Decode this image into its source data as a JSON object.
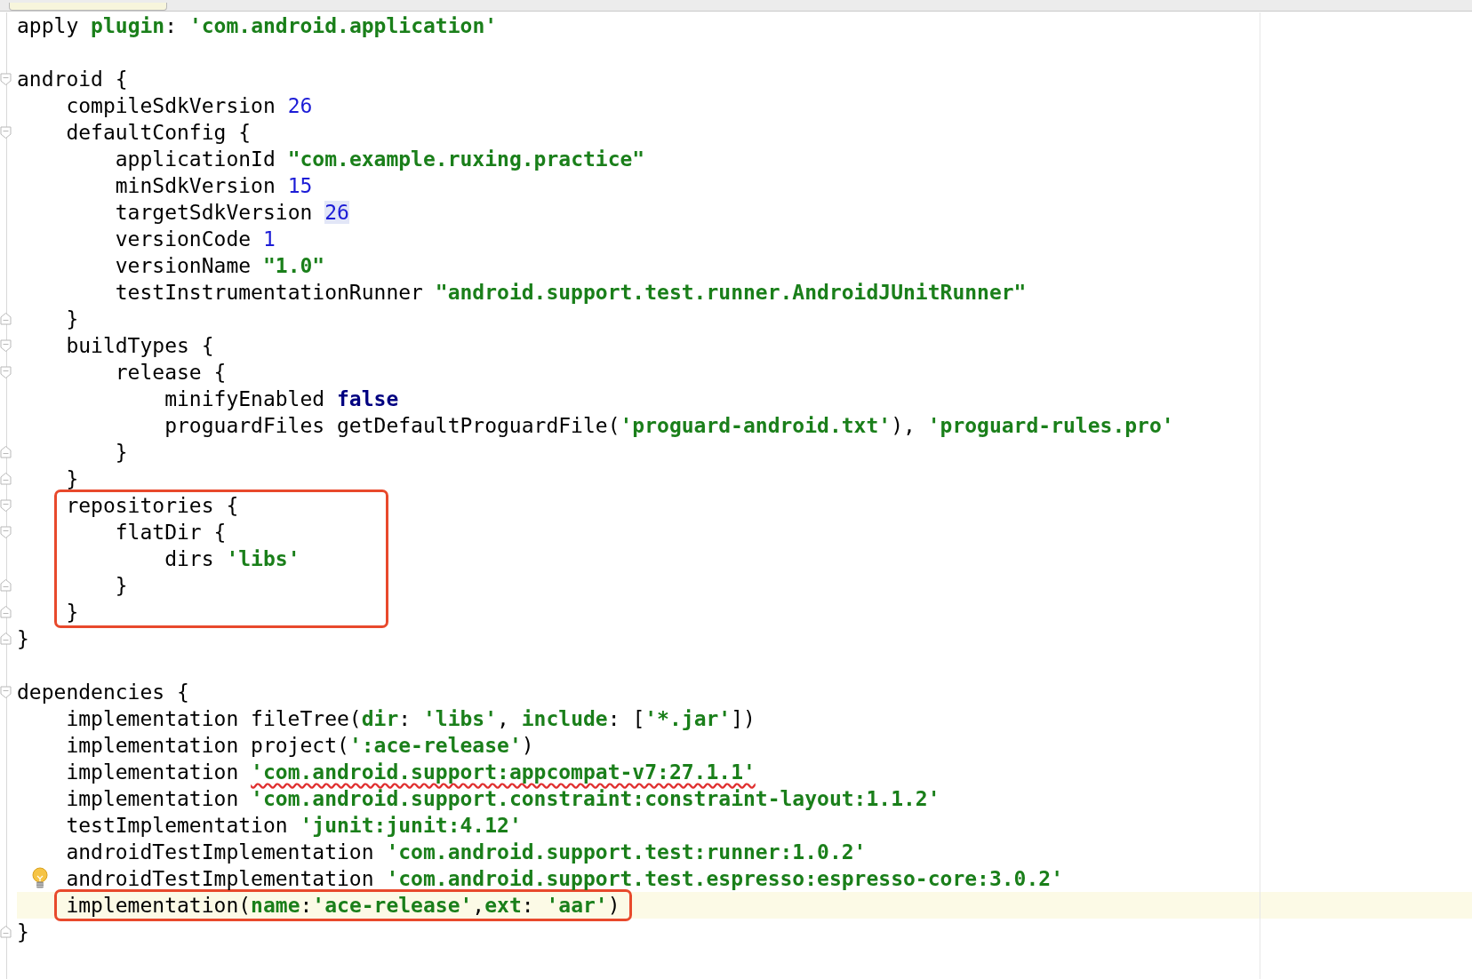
{
  "editor": {
    "blocks": [
      {
        "boxed": false,
        "lines": [
          {
            "current": false,
            "bulb": false,
            "tokens": [
              {
                "t": "apply ",
                "kind": "plain"
              },
              {
                "t": "plugin",
                "kind": "string"
              },
              {
                "t": ": ",
                "kind": "plain"
              },
              {
                "t": "'com.android.application'",
                "kind": "string"
              }
            ]
          },
          {
            "current": false,
            "bulb": false
          },
          {
            "current": false,
            "bulb": false,
            "tokens": [
              {
                "t": "android {",
                "kind": "plain"
              }
            ]
          },
          {
            "current": false,
            "bulb": false,
            "tokens": [
              {
                "t": "    compileSdkVersion ",
                "kind": "plain"
              },
              {
                "t": "26",
                "kind": "number"
              }
            ]
          },
          {
            "current": false,
            "bulb": false,
            "tokens": [
              {
                "t": "    defaultConfig {",
                "kind": "plain"
              }
            ]
          },
          {
            "current": false,
            "bulb": false,
            "tokens": [
              {
                "t": "        applicationId ",
                "kind": "plain"
              },
              {
                "t": "\"com.example.ruxing.practice\"",
                "kind": "string"
              }
            ]
          },
          {
            "current": false,
            "bulb": false,
            "tokens": [
              {
                "t": "        minSdkVersion ",
                "kind": "plain"
              },
              {
                "t": "15",
                "kind": "number"
              }
            ]
          },
          {
            "current": false,
            "bulb": false,
            "tokens": [
              {
                "t": "        targetSdkVersion ",
                "kind": "plain"
              },
              {
                "t": "26",
                "kind": "number-match"
              }
            ]
          },
          {
            "current": false,
            "bulb": false,
            "tokens": [
              {
                "t": "        versionCode ",
                "kind": "plain"
              },
              {
                "t": "1",
                "kind": "number"
              }
            ]
          },
          {
            "current": false,
            "bulb": false,
            "tokens": [
              {
                "t": "        versionName ",
                "kind": "plain"
              },
              {
                "t": "\"1.0\"",
                "kind": "string"
              }
            ]
          },
          {
            "current": false,
            "bulb": false,
            "tokens": [
              {
                "t": "        testInstrumentationRunner ",
                "kind": "plain"
              },
              {
                "t": "\"android.support.test.runner.AndroidJUnitRunner\"",
                "kind": "string"
              }
            ]
          },
          {
            "current": false,
            "bulb": false,
            "tokens": [
              {
                "t": "    }",
                "kind": "plain"
              }
            ]
          },
          {
            "current": false,
            "bulb": false,
            "tokens": [
              {
                "t": "    buildTypes {",
                "kind": "plain"
              }
            ]
          },
          {
            "current": false,
            "bulb": false,
            "tokens": [
              {
                "t": "        release {",
                "kind": "plain"
              }
            ]
          },
          {
            "current": false,
            "bulb": false,
            "tokens": [
              {
                "t": "            minifyEnabled ",
                "kind": "plain"
              },
              {
                "t": "false",
                "kind": "keyword"
              }
            ]
          },
          {
            "current": false,
            "bulb": false,
            "tokens": [
              {
                "t": "            proguardFiles getDefaultProguardFile(",
                "kind": "plain"
              },
              {
                "t": "'proguard-android.txt'",
                "kind": "string"
              },
              {
                "t": "), ",
                "kind": "plain"
              },
              {
                "t": "'proguard-rules.pro'",
                "kind": "string"
              }
            ]
          },
          {
            "current": false,
            "bulb": false,
            "tokens": [
              {
                "t": "        }",
                "kind": "plain"
              }
            ]
          },
          {
            "current": false,
            "bulb": false,
            "tokens": [
              {
                "t": "    }",
                "kind": "plain"
              }
            ]
          }
        ]
      },
      {
        "boxed": true,
        "lines": [
          {
            "current": false,
            "bulb": false,
            "tokens": [
              {
                "t": "    repositories {",
                "kind": "plain"
              }
            ]
          },
          {
            "current": false,
            "bulb": false,
            "tokens": [
              {
                "t": "        flatDir {",
                "kind": "plain"
              }
            ]
          },
          {
            "current": false,
            "bulb": false,
            "tokens": [
              {
                "t": "            dirs ",
                "kind": "plain"
              },
              {
                "t": "'libs'",
                "kind": "string"
              }
            ]
          },
          {
            "current": false,
            "bulb": false,
            "tokens": [
              {
                "t": "        }",
                "kind": "plain"
              }
            ]
          },
          {
            "current": false,
            "bulb": false,
            "tokens": [
              {
                "t": "    }",
                "kind": "plain"
              }
            ]
          }
        ]
      },
      {
        "boxed": false,
        "lines": [
          {
            "current": false,
            "bulb": false,
            "tokens": [
              {
                "t": "}",
                "kind": "plain"
              }
            ]
          },
          {
            "current": false,
            "bulb": false
          },
          {
            "current": false,
            "bulb": false,
            "tokens": [
              {
                "t": "dependencies {",
                "kind": "plain"
              }
            ]
          },
          {
            "current": false,
            "bulb": false,
            "tokens": [
              {
                "t": "    implementation fileTree(",
                "kind": "plain"
              },
              {
                "t": "dir",
                "kind": "string"
              },
              {
                "t": ": ",
                "kind": "plain"
              },
              {
                "t": "'libs'",
                "kind": "string"
              },
              {
                "t": ", ",
                "kind": "plain"
              },
              {
                "t": "include",
                "kind": "string"
              },
              {
                "t": ": [",
                "kind": "plain"
              },
              {
                "t": "'*.jar'",
                "kind": "string"
              },
              {
                "t": "])",
                "kind": "plain"
              }
            ]
          },
          {
            "current": false,
            "bulb": false,
            "tokens": [
              {
                "t": "    implementation project(",
                "kind": "plain"
              },
              {
                "t": "':ace-release'",
                "kind": "string"
              },
              {
                "t": ")",
                "kind": "plain"
              }
            ]
          },
          {
            "current": false,
            "bulb": false,
            "tokens": [
              {
                "t": "    implementation ",
                "kind": "plain"
              },
              {
                "t": "'com.android.support:appcompat-v7:27.1.1'",
                "kind": "string-warning"
              }
            ]
          },
          {
            "current": false,
            "bulb": false,
            "tokens": [
              {
                "t": "    implementation ",
                "kind": "plain"
              },
              {
                "t": "'com.android.support.constraint:constraint-layout:1.1.2'",
                "kind": "string"
              }
            ]
          },
          {
            "current": false,
            "bulb": false,
            "tokens": [
              {
                "t": "    testImplementation ",
                "kind": "plain"
              },
              {
                "t": "'junit:junit:4.12'",
                "kind": "string"
              }
            ]
          },
          {
            "current": false,
            "bulb": false,
            "tokens": [
              {
                "t": "    androidTestImplementation ",
                "kind": "plain"
              },
              {
                "t": "'com.android.support.test:runner:1.0.2'",
                "kind": "string"
              }
            ]
          },
          {
            "current": false,
            "bulb": true,
            "tokens": [
              {
                "t": "    androidTestImplementation ",
                "kind": "plain"
              },
              {
                "t": "'com.android.support.test.espresso:espresso-core:3.0.2'",
                "kind": "string"
              }
            ]
          }
        ]
      },
      {
        "boxed": true,
        "lines": [
          {
            "current": true,
            "bulb": false,
            "tokens": [
              {
                "t": "    implementation(",
                "kind": "plain"
              },
              {
                "t": "name",
                "kind": "string"
              },
              {
                "t": ":",
                "kind": "plain"
              },
              {
                "t": "'ace-release'",
                "kind": "string"
              },
              {
                "t": ",",
                "kind": "plain"
              },
              {
                "t": "ext",
                "kind": "string"
              },
              {
                "t": ": ",
                "kind": "plain"
              },
              {
                "t": "'aar'",
                "kind": "string"
              },
              {
                "t": ")",
                "kind": "plain"
              }
            ]
          }
        ]
      },
      {
        "boxed": false,
        "lines": [
          {
            "current": false,
            "bulb": false,
            "tokens": [
              {
                "t": "}",
                "kind": "plain"
              }
            ]
          }
        ]
      }
    ]
  }
}
